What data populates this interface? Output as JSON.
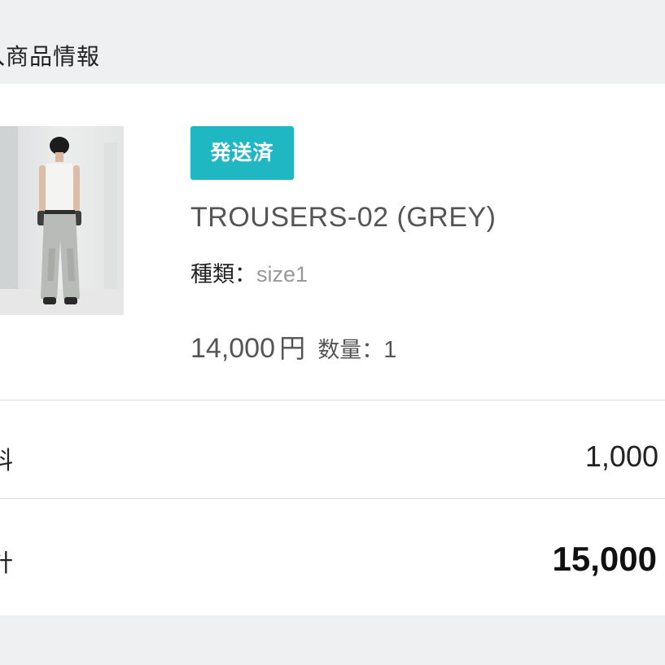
{
  "section": {
    "title": "入商品情報"
  },
  "product": {
    "image_alt": "TROUSERS-02 (GREY)",
    "status_badge": "発送済",
    "status_color": "#1fb7c1",
    "name": "TROUSERS-02 (GREY)",
    "variant_label": "種類：",
    "variant_value": "size1",
    "price": "14,000",
    "currency": "円",
    "quantity_label": "数量：",
    "quantity": "1"
  },
  "summary": {
    "shipping_label": "料",
    "shipping_value": "1,000",
    "total_label": "計",
    "total_value": "15,000"
  }
}
